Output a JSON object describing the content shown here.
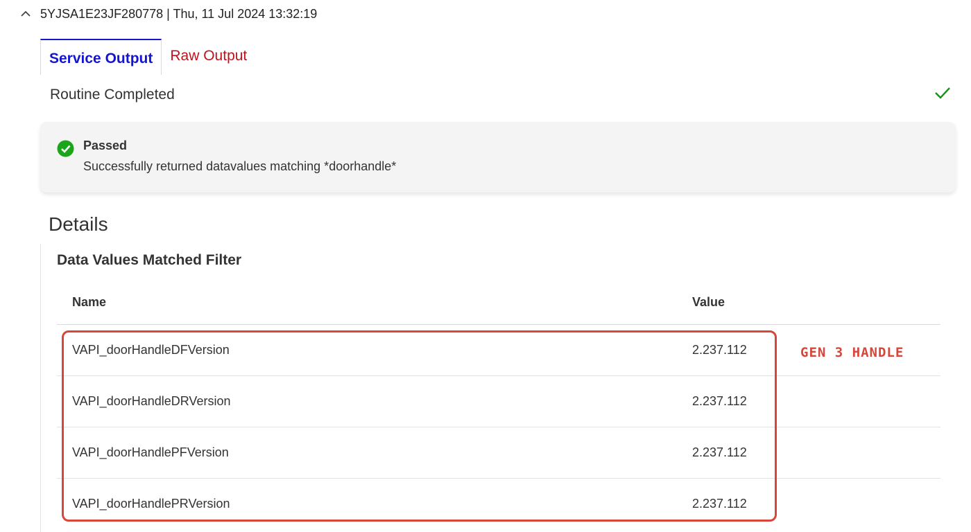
{
  "header": {
    "title": "5YJSA1E23JF280778 | Thu, 11 Jul 2024 13:32:19"
  },
  "tabs": [
    {
      "label": "Service Output",
      "active": true
    },
    {
      "label": "Raw Output",
      "active": false
    }
  ],
  "routine": {
    "status_text": "Routine Completed",
    "status_icon": "checkmark-icon",
    "status_color": "#1a8f1a"
  },
  "result": {
    "title": "Passed",
    "description": "Successfully returned datavalues matching *doorhandle*",
    "icon": "check-circle-icon",
    "color": "#1aa51a"
  },
  "details": {
    "heading": "Details",
    "section_title": "Data Values Matched Filter",
    "columns": {
      "name": "Name",
      "value": "Value"
    },
    "rows": [
      {
        "name": "VAPI_doorHandleDFVersion",
        "value": "2.237.112"
      },
      {
        "name": "VAPI_doorHandleDRVersion",
        "value": "2.237.112"
      },
      {
        "name": "VAPI_doorHandlePFVersion",
        "value": "2.237.112"
      },
      {
        "name": "VAPI_doorHandlePRVersion",
        "value": "2.237.112"
      }
    ]
  },
  "annotation": {
    "label": "GEN 3 HANDLE",
    "color": "#d6463a"
  }
}
